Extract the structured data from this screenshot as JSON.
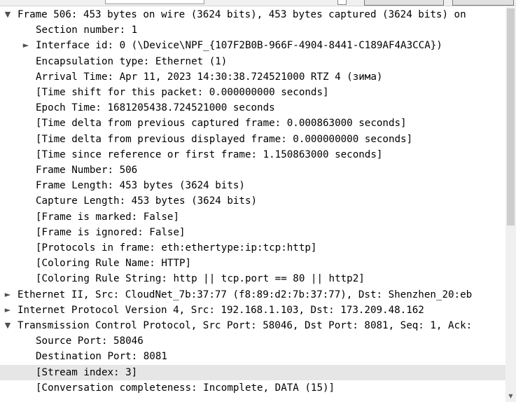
{
  "tree": {
    "rows": [
      {
        "level": 0,
        "expander": "expanded",
        "text": "Frame 506: 453 bytes on wire (3624 bits), 453 bytes captured (3624 bits) on"
      },
      {
        "level": 1,
        "expander": "none",
        "text": "Section number: 1"
      },
      {
        "level": 1,
        "expander": "collapsed",
        "text": "Interface id: 0 (\\Device\\NPF_{107F2B0B-966F-4904-8441-C189AF4A3CCA})"
      },
      {
        "level": 1,
        "expander": "none",
        "text": "Encapsulation type: Ethernet (1)"
      },
      {
        "level": 1,
        "expander": "none",
        "text": "Arrival Time: Apr 11, 2023 14:30:38.724521000 RTZ 4 (зима)"
      },
      {
        "level": 1,
        "expander": "none",
        "text": "[Time shift for this packet: 0.000000000 seconds]"
      },
      {
        "level": 1,
        "expander": "none",
        "text": "Epoch Time: 1681205438.724521000 seconds"
      },
      {
        "level": 1,
        "expander": "none",
        "text": "[Time delta from previous captured frame: 0.000863000 seconds]"
      },
      {
        "level": 1,
        "expander": "none",
        "text": "[Time delta from previous displayed frame: 0.000000000 seconds]"
      },
      {
        "level": 1,
        "expander": "none",
        "text": "[Time since reference or first frame: 1.150863000 seconds]"
      },
      {
        "level": 1,
        "expander": "none",
        "text": "Frame Number: 506"
      },
      {
        "level": 1,
        "expander": "none",
        "text": "Frame Length: 453 bytes (3624 bits)"
      },
      {
        "level": 1,
        "expander": "none",
        "text": "Capture Length: 453 bytes (3624 bits)"
      },
      {
        "level": 1,
        "expander": "none",
        "text": "[Frame is marked: False]"
      },
      {
        "level": 1,
        "expander": "none",
        "text": "[Frame is ignored: False]"
      },
      {
        "level": 1,
        "expander": "none",
        "text": "[Protocols in frame: eth:ethertype:ip:tcp:http]"
      },
      {
        "level": 1,
        "expander": "none",
        "text": "[Coloring Rule Name: HTTP]"
      },
      {
        "level": 1,
        "expander": "none",
        "text": "[Coloring Rule String: http || tcp.port == 80 || http2]"
      },
      {
        "level": 0,
        "expander": "collapsed",
        "text": "Ethernet II, Src: CloudNet_7b:37:77 (f8:89:d2:7b:37:77), Dst: Shenzhen_20:eb"
      },
      {
        "level": 0,
        "expander": "collapsed",
        "text": "Internet Protocol Version 4, Src: 192.168.1.103, Dst: 173.209.48.162"
      },
      {
        "level": 0,
        "expander": "expanded",
        "text": "Transmission Control Protocol, Src Port: 58046, Dst Port: 8081, Seq: 1, Ack:"
      },
      {
        "level": 1,
        "expander": "none",
        "text": "Source Port: 58046"
      },
      {
        "level": 1,
        "expander": "none",
        "text": "Destination Port: 8081"
      },
      {
        "level": 1,
        "expander": "none",
        "text": "[Stream index: 3]",
        "selected": true
      },
      {
        "level": 1,
        "expander": "none",
        "text": "[Conversation completeness: Incomplete, DATA (15)]"
      }
    ]
  },
  "icons": {
    "expanded": "chevron-down-icon",
    "collapsed": "chevron-right-icon",
    "scroll_down": "scroll-down-arrow-icon"
  },
  "colors": {
    "selected_row": "#e6e6e6",
    "scrollbar_thumb": "#cdcdcd",
    "background": "#ffffff"
  }
}
